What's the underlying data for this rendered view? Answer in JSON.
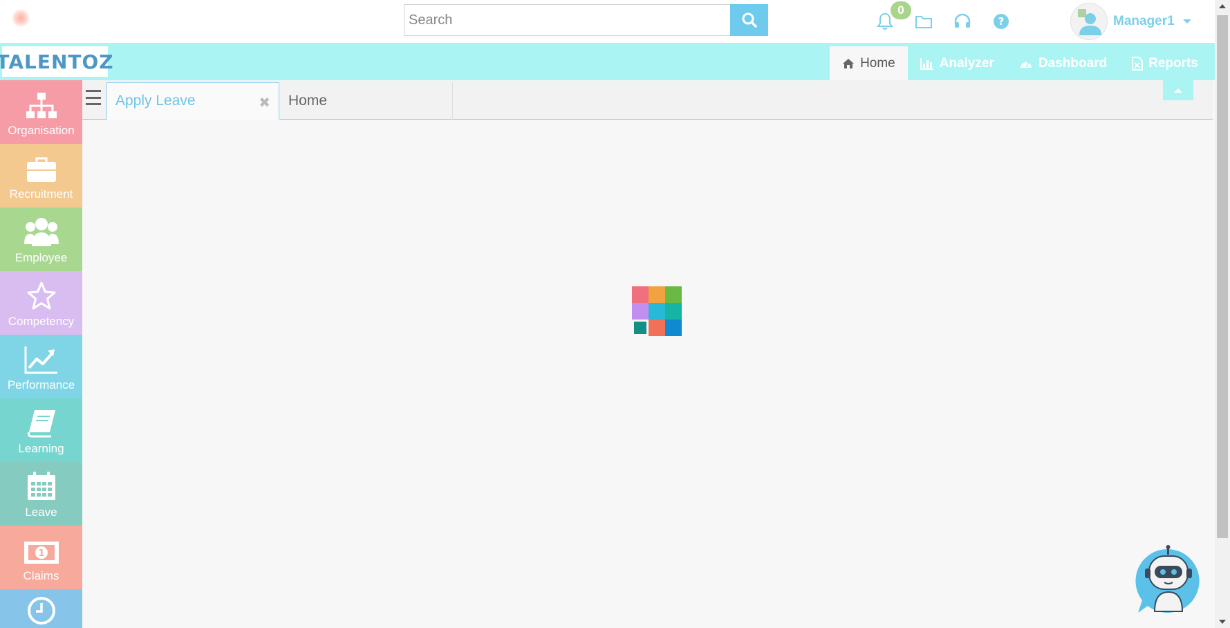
{
  "search": {
    "placeholder": "Search"
  },
  "notifications": {
    "count": "0"
  },
  "user": {
    "name": "Manager1"
  },
  "brand": {
    "logo_text": "TALENTOZ"
  },
  "nav": [
    {
      "label": "Home",
      "icon": "home-icon"
    },
    {
      "label": "Analyzer",
      "icon": "bar-chart-icon"
    },
    {
      "label": "Dashboard",
      "icon": "dashboard-icon"
    },
    {
      "label": "Reports",
      "icon": "report-file-icon"
    }
  ],
  "sidebar": {
    "items": [
      {
        "label": "Organisation",
        "color": "#f59ca6",
        "icon": "org-chart-icon"
      },
      {
        "label": "Recruitment",
        "color": "#f3c98f",
        "icon": "briefcase-icon"
      },
      {
        "label": "Employee",
        "color": "#a8d88f",
        "icon": "people-icon"
      },
      {
        "label": "Competency",
        "color": "#d9bdf0",
        "icon": "star-icon"
      },
      {
        "label": "Performance",
        "color": "#7fd5e6",
        "icon": "trend-chart-icon"
      },
      {
        "label": "Learning",
        "color": "#76d6cf",
        "icon": "book-icon"
      },
      {
        "label": "Leave",
        "color": "#86cbbf",
        "icon": "calendar-icon"
      },
      {
        "label": "Claims",
        "color": "#f7a99b",
        "icon": "money-icon"
      },
      {
        "label": "",
        "color": "#86c5e9",
        "icon": "clock-icon"
      }
    ]
  },
  "tabs": [
    {
      "label": "Apply Leave",
      "active": true
    },
    {
      "label": "Home",
      "active": false
    }
  ],
  "loader_colors": [
    "#f0707f",
    "#f0a340",
    "#6ab944",
    "#c18ff0",
    "#28b8d8",
    "#16b4a4",
    "#138f86",
    "#f07058",
    "#0f8ad0"
  ]
}
